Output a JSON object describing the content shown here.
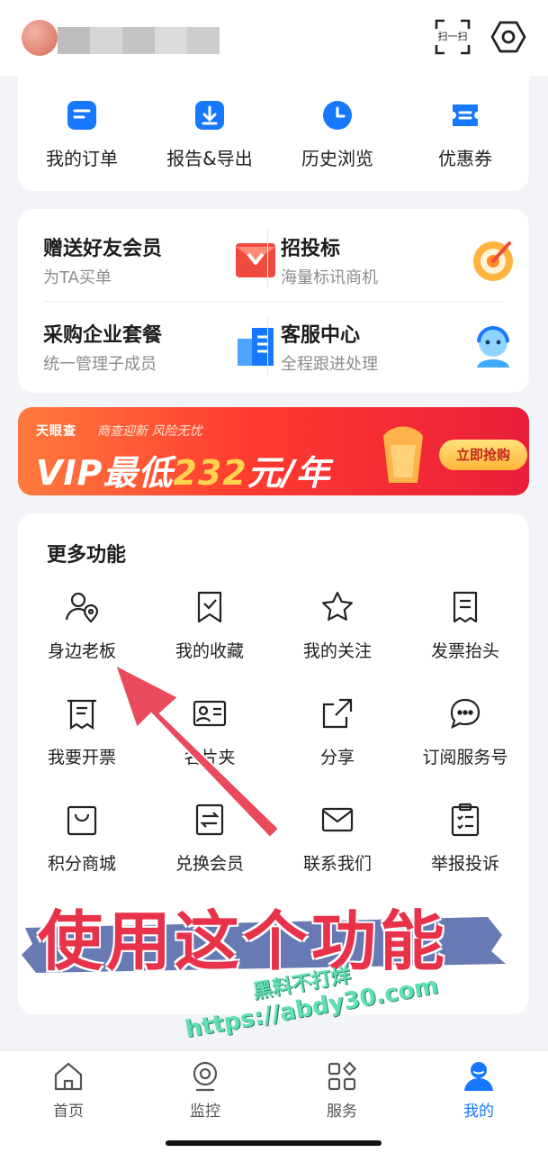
{
  "top_bar": {
    "scan_label": "扫一扫",
    "username_blurred_colors": [
      "#bdbdbd",
      "#d6d6d6",
      "#c4c4c4",
      "#dcdcdc",
      "#cdcdcd"
    ]
  },
  "quick_actions": [
    {
      "label": "我的订单",
      "icon": "order-icon"
    },
    {
      "label": "报告&导出",
      "icon": "download-icon"
    },
    {
      "label": "历史浏览",
      "icon": "clock-icon"
    },
    {
      "label": "优惠券",
      "icon": "coupon-icon"
    }
  ],
  "promos": [
    {
      "title": "赠送好友会员",
      "subtitle": "为TA买单",
      "icon": "gift-envelope-icon"
    },
    {
      "title": "招投标",
      "subtitle": "海量标讯商机",
      "icon": "target-icon"
    },
    {
      "title": "采购企业套餐",
      "subtitle": "统一管理子成员",
      "icon": "building-icon"
    },
    {
      "title": "客服中心",
      "subtitle": "全程跟进处理",
      "icon": "customer-service-icon"
    }
  ],
  "vip_banner": {
    "brand": "天眼查",
    "slogan": "商查迎新 风险无忧",
    "headline_prefix": "VIP最低",
    "headline_price": "232",
    "headline_suffix": "元/年",
    "cta": "立即抢购"
  },
  "more_features": {
    "title": "更多功能",
    "items": [
      {
        "label": "身边老板",
        "icon": "nearby-boss-icon"
      },
      {
        "label": "我的收藏",
        "icon": "bookmark-check-icon"
      },
      {
        "label": "我的关注",
        "icon": "star-icon"
      },
      {
        "label": "发票抬头",
        "icon": "invoice-icon"
      },
      {
        "label": "我要开票",
        "icon": "receipt-icon"
      },
      {
        "label": "名片夹",
        "icon": "business-card-icon"
      },
      {
        "label": "分享",
        "icon": "share-icon"
      },
      {
        "label": "订阅服务号",
        "icon": "chat-bubble-icon"
      },
      {
        "label": "积分商城",
        "icon": "shopping-bag-icon"
      },
      {
        "label": "兑换会员",
        "icon": "exchange-icon"
      },
      {
        "label": "联系我们",
        "icon": "mail-icon"
      },
      {
        "label": "举报投诉",
        "icon": "clipboard-icon"
      }
    ]
  },
  "overlay": {
    "caption": "使用这个功能",
    "watermark_line1": "黑料不打烊",
    "watermark_line2": "https://abdy30.com"
  },
  "tabs": [
    {
      "label": "首页",
      "icon": "home-icon",
      "active": false
    },
    {
      "label": "监控",
      "icon": "monitor-icon",
      "active": false
    },
    {
      "label": "服务",
      "icon": "grid-icon",
      "active": false
    },
    {
      "label": "我的",
      "icon": "user-icon",
      "active": true
    }
  ],
  "colors": {
    "accent_blue": "#1677ff",
    "caption_red": "#e8324a",
    "arrow_red": "#e94a5c",
    "brush_blue": "#5a6fae",
    "watermark_green": "#5fe0b4"
  }
}
